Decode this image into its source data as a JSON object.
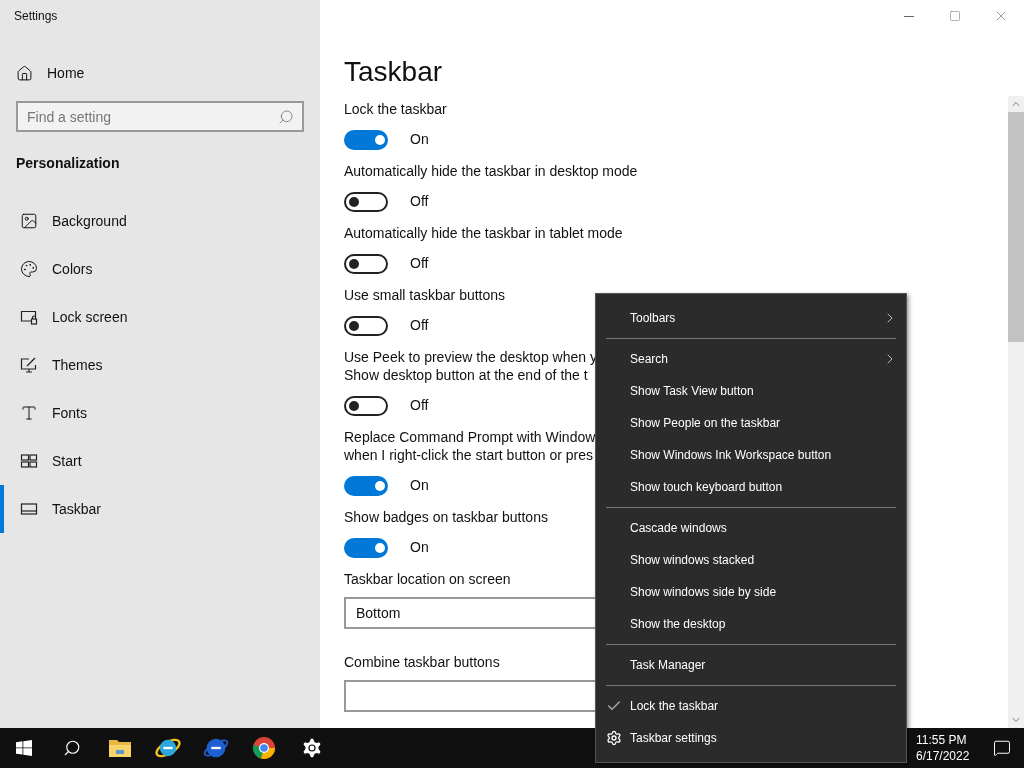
{
  "window": {
    "title": "Settings"
  },
  "sidebar": {
    "home": "Home",
    "search": {
      "placeholder": "Find a setting"
    },
    "section": "Personalization",
    "items": [
      {
        "label": "Background",
        "selected": false
      },
      {
        "label": "Colors",
        "selected": false
      },
      {
        "label": "Lock screen",
        "selected": false
      },
      {
        "label": "Themes",
        "selected": false
      },
      {
        "label": "Fonts",
        "selected": false
      },
      {
        "label": "Start",
        "selected": false
      },
      {
        "label": "Taskbar",
        "selected": true
      }
    ]
  },
  "page": {
    "title": "Taskbar",
    "settings": [
      {
        "kind": "toggle",
        "lines": [
          "Lock the taskbar"
        ],
        "on": true,
        "state": "On"
      },
      {
        "kind": "toggle",
        "lines": [
          "Automatically hide the taskbar in desktop mode"
        ],
        "on": false,
        "state": "Off"
      },
      {
        "kind": "toggle",
        "lines": [
          "Automatically hide the taskbar in tablet mode"
        ],
        "on": false,
        "state": "Off"
      },
      {
        "kind": "toggle",
        "lines": [
          "Use small taskbar buttons"
        ],
        "on": false,
        "state": "Off"
      },
      {
        "kind": "toggle",
        "lines": [
          "Use Peek to preview the desktop when y",
          "Show desktop button at the end of the t"
        ],
        "on": false,
        "state": "Off"
      },
      {
        "kind": "toggle",
        "lines": [
          "Replace Command Prompt with Window",
          "when I right-click the start button or pres"
        ],
        "on": true,
        "state": "On"
      },
      {
        "kind": "toggle",
        "lines": [
          "Show badges on taskbar buttons"
        ],
        "on": true,
        "state": "On"
      },
      {
        "kind": "dropdown",
        "lines": [
          "Taskbar location on screen"
        ],
        "value": "Bottom"
      },
      {
        "kind": "dropdown",
        "lines": [
          "Combine taskbar buttons"
        ]
      }
    ]
  },
  "context_menu": {
    "groups": [
      [
        {
          "kind": "submenu",
          "label": "Toolbars"
        }
      ],
      [
        {
          "kind": "submenu",
          "label": "Search"
        },
        {
          "kind": "item",
          "label": "Show Task View button"
        },
        {
          "kind": "item",
          "label": "Show People on the taskbar"
        },
        {
          "kind": "item",
          "label": "Show Windows Ink Workspace button"
        },
        {
          "kind": "item",
          "label": "Show touch keyboard button"
        }
      ],
      [
        {
          "kind": "item",
          "label": "Cascade windows"
        },
        {
          "kind": "item",
          "label": "Show windows stacked"
        },
        {
          "kind": "item",
          "label": "Show windows side by side"
        },
        {
          "kind": "item",
          "label": "Show the desktop"
        }
      ],
      [
        {
          "kind": "item",
          "label": "Task Manager"
        }
      ],
      [
        {
          "kind": "check",
          "label": "Lock the taskbar",
          "checked": true
        },
        {
          "kind": "settings",
          "label": "Taskbar settings"
        }
      ]
    ]
  },
  "taskbar": {
    "time": "11:55 PM",
    "date": "6/17/2022"
  }
}
